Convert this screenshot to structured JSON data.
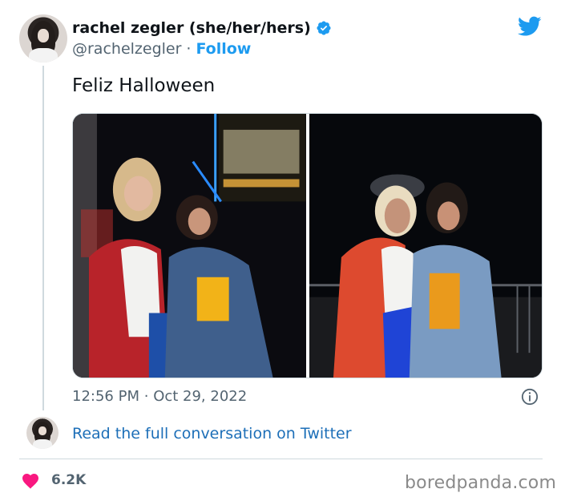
{
  "author": {
    "display_name": "rachel zegler (she/her/hers)",
    "handle": "@rachelzegler",
    "separator": "·",
    "follow_label": "Follow"
  },
  "tweet": {
    "text": "Feliz Halloween",
    "time": "12:56 PM",
    "date": "Oct 29, 2022",
    "meta_separator": "·"
  },
  "conversation": {
    "link_text": "Read the full conversation on Twitter"
  },
  "engagement": {
    "likes": "6.2K"
  },
  "watermark": "boredpanda.com",
  "colors": {
    "twitter_blue": "#1d9bf0",
    "heart": "#f91880",
    "secondary_text": "#536471"
  },
  "icons": {
    "verified": "verified-badge-icon",
    "brand": "twitter-bird-icon",
    "info": "info-icon",
    "like": "heart-icon"
  }
}
